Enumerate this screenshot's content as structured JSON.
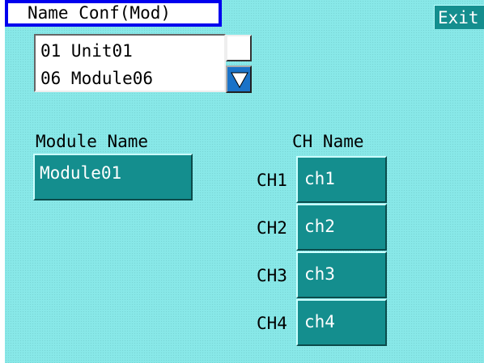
{
  "header": {
    "title": "Name Conf(Mod)",
    "exit_label": "Exit"
  },
  "unit_list": {
    "items": [
      {
        "label": "01 Unit01"
      },
      {
        "label": "06 Module06"
      }
    ]
  },
  "module": {
    "heading": "Module Name",
    "value": "Module01"
  },
  "channels": {
    "heading": "CH Name",
    "items": [
      {
        "label": "CH1",
        "value": "ch1"
      },
      {
        "label": "CH2",
        "value": "ch2"
      },
      {
        "label": "CH3",
        "value": "ch3"
      },
      {
        "label": "CH4",
        "value": "ch4"
      }
    ]
  },
  "icons": {
    "scroll_down": "triangle-down-icon"
  },
  "colors": {
    "background": "#88e8e8",
    "field": "#148e8e",
    "title_border": "#0000ee",
    "scroll_button": "#1a73c8"
  }
}
